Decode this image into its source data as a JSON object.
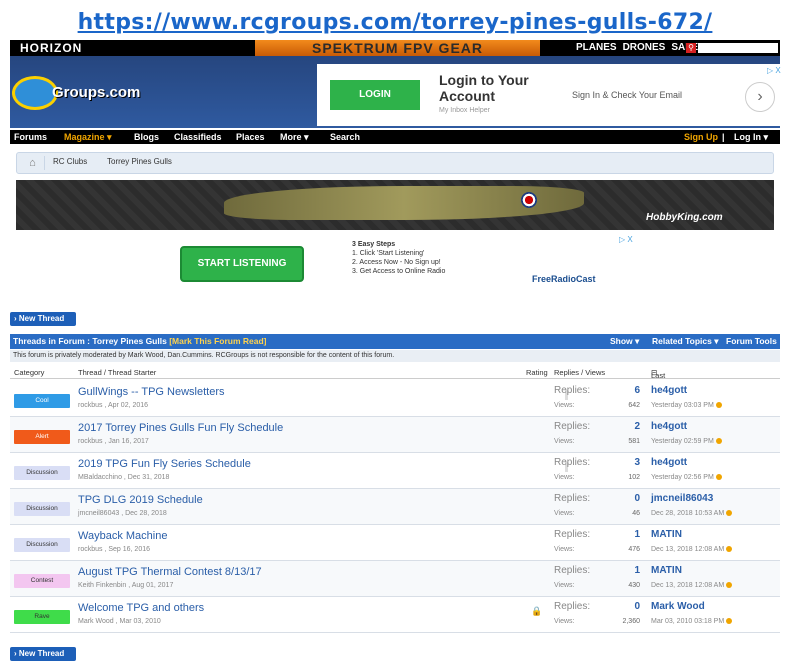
{
  "url": "https://www.rcgroups.com/torrey-pines-gulls-672/",
  "topbar": {
    "logo": "HORIZON",
    "banner": "SPEKTRUM FPV GEAR",
    "nav": [
      "PLANES",
      "DRONES",
      "SALES"
    ]
  },
  "header": {
    "site_name": "Groups.com",
    "ad": {
      "button": "LOGIN",
      "title": "Login to Your Account",
      "subtitle": "My Inbox Helper",
      "right_text": "Sign In & Check Your Email",
      "arrow": "›",
      "badge": "▷ X"
    }
  },
  "navbar": {
    "items": [
      "Forums",
      "Magazine ▾",
      "Blogs",
      "Classifieds",
      "Places",
      "More ▾",
      "Search"
    ],
    "sign_up": "Sign Up",
    "log_in": "Log In ▾",
    "separator": "|"
  },
  "breadcrumb": [
    "RC Clubs",
    "Torrey Pines Gulls"
  ],
  "banner_ad": {
    "brand": "HobbyKing.com"
  },
  "ad2": {
    "button": "START LISTENING",
    "steps": [
      "3 Easy Steps",
      "1. Click 'Start Listening'",
      "2. Access Now - No Sign up!",
      "3. Get Access to Online Radio"
    ],
    "brand": "FreeRadioCast",
    "badge": "▷ X"
  },
  "new_thread_label": "New Thread",
  "forum": {
    "threads_in": "Threads in Forum : Torrey Pines Gulls",
    "mark_read": "[Mark This Forum Read]",
    "show": "Show ▾",
    "related": "Related Topics ▾",
    "tools": "Forum Tools ▾",
    "notice": "This forum is privately moderated by Mark Wood, Dan.Cummins. RCGroups is not responsible for the content of this forum.",
    "columns": {
      "category": "Category",
      "thread": "Thread / Thread Starter",
      "rating": "Rating",
      "replies": "Replies / Views",
      "last_post": "Last Post"
    }
  },
  "threads": [
    {
      "tag": "Cool",
      "tag_bg": "#2f9be6",
      "tag_fg": "#ffffff",
      "title": "GullWings -- TPG Newsletters",
      "starter": "rockbus , Apr 02, 2016",
      "replies": "6",
      "views": "642",
      "last_user": "he4gott",
      "last_date": "Yesterday 03:03 PM"
    },
    {
      "tag": "Alert",
      "tag_bg": "#f05a1a",
      "tag_fg": "#ffffff",
      "title": "2017 Torrey Pines Gulls Fun Fly Schedule",
      "starter": "rockbus , Jan 16, 2017",
      "replies": "2",
      "views": "581",
      "last_user": "he4gott",
      "last_date": "Yesterday 02:59 PM"
    },
    {
      "tag": "Discussion",
      "tag_bg": "#d9def5",
      "tag_fg": "#333333",
      "title": "2019 TPG Fun Fly Series Schedule",
      "starter": "MBaldacchino , Dec 31, 2018",
      "replies": "3",
      "views": "102",
      "last_user": "he4gott",
      "last_date": "Yesterday 02:56 PM"
    },
    {
      "tag": "Discussion",
      "tag_bg": "#d9def5",
      "tag_fg": "#333333",
      "title": "TPG DLG 2019 Schedule",
      "starter": "jmcneil86043 , Dec 28, 2018",
      "replies": "0",
      "views": "46",
      "last_user": "jmcneil86043",
      "last_date": "Dec 28, 2018 10:53 AM"
    },
    {
      "tag": "Discussion",
      "tag_bg": "#d9def5",
      "tag_fg": "#333333",
      "title": "Wayback Machine",
      "starter": "rockbus , Sep 16, 2016",
      "replies": "1",
      "views": "476",
      "last_user": "MATIN",
      "last_date": "Dec 13, 2018 12:08 AM"
    },
    {
      "tag": "Contest",
      "tag_bg": "#f3c6f0",
      "tag_fg": "#333333",
      "title": "August TPG Thermal Contest 8/13/17",
      "starter": "Keith Finkenbin , Aug 01, 2017",
      "replies": "1",
      "views": "430",
      "last_user": "MATIN",
      "last_date": "Dec 13, 2018 12:08 AM"
    },
    {
      "tag": "Rave",
      "tag_bg": "#3fdc4a",
      "tag_fg": "#333333",
      "title": "Welcome TPG and others",
      "starter": "Mark Wood , Mar 03, 2010",
      "replies": "0",
      "views": "2,360",
      "last_user": "Mark Wood",
      "last_date": "Mar 03, 2010 03:18 PM"
    }
  ],
  "labels": {
    "replies": "Replies:",
    "views": "Views:"
  }
}
